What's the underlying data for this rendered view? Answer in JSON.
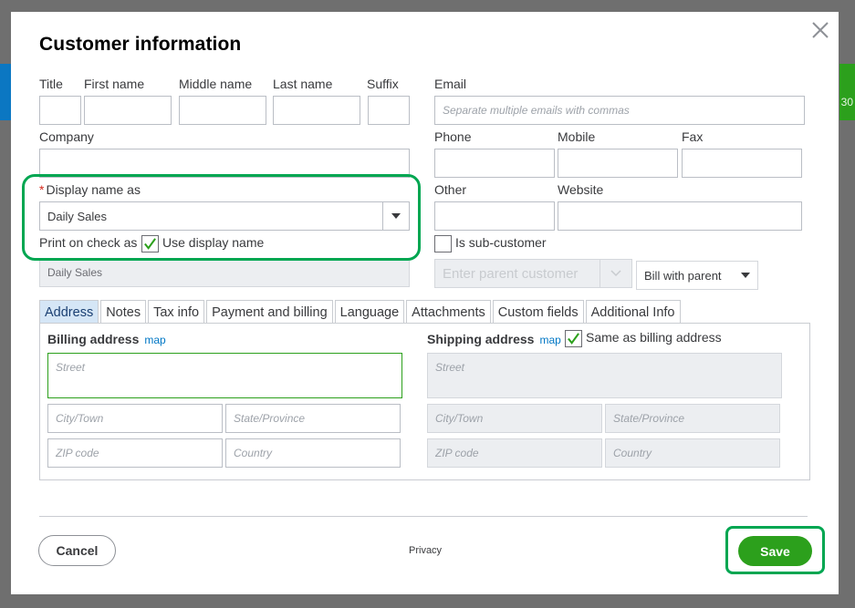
{
  "background": {
    "right_text": "30"
  },
  "dialog": {
    "title": "Customer information",
    "close_label": "×"
  },
  "name_section": {
    "title_label": "Title",
    "first_name_label": "First name",
    "middle_name_label": "Middle name",
    "last_name_label": "Last name",
    "suffix_label": "Suffix",
    "company_label": "Company",
    "display_name_label": "Display name as",
    "display_name_value": "Daily Sales",
    "print_on_check_label": "Print on check as",
    "use_display_name_label": "Use display name",
    "use_display_name_checked": true,
    "print_on_check_value": "Daily Sales"
  },
  "contact_section": {
    "email_label": "Email",
    "email_placeholder": "Separate multiple emails with commas",
    "phone_label": "Phone",
    "mobile_label": "Mobile",
    "fax_label": "Fax",
    "other_label": "Other",
    "website_label": "Website",
    "sub_customer_label": "Is sub-customer",
    "sub_customer_checked": false,
    "parent_customer_placeholder": "Enter parent customer",
    "bill_with_parent": "Bill with parent"
  },
  "tabs": [
    {
      "label": "Address",
      "active": true
    },
    {
      "label": "Notes",
      "active": false
    },
    {
      "label": "Tax info",
      "active": false
    },
    {
      "label": "Payment and billing",
      "active": false
    },
    {
      "label": "Language",
      "active": false
    },
    {
      "label": "Attachments",
      "active": false
    },
    {
      "label": "Custom fields",
      "active": false
    },
    {
      "label": "Additional Info",
      "active": false
    }
  ],
  "address": {
    "billing_label": "Billing address",
    "billing_map": "map",
    "shipping_label": "Shipping address",
    "shipping_map": "map",
    "same_as_billing_label": "Same as billing address",
    "same_as_billing_checked": true,
    "street_placeholder": "Street",
    "city_placeholder": "City/Town",
    "state_placeholder": "State/Province",
    "zip_placeholder": "ZIP code",
    "country_placeholder": "Country"
  },
  "footer": {
    "cancel_label": "Cancel",
    "privacy_label": "Privacy",
    "save_label": "Save"
  },
  "colors": {
    "accent_green": "#2ca01c",
    "highlight_green": "#00a651",
    "active_tab": "#d5e6f6",
    "link_blue": "#0077c5"
  }
}
